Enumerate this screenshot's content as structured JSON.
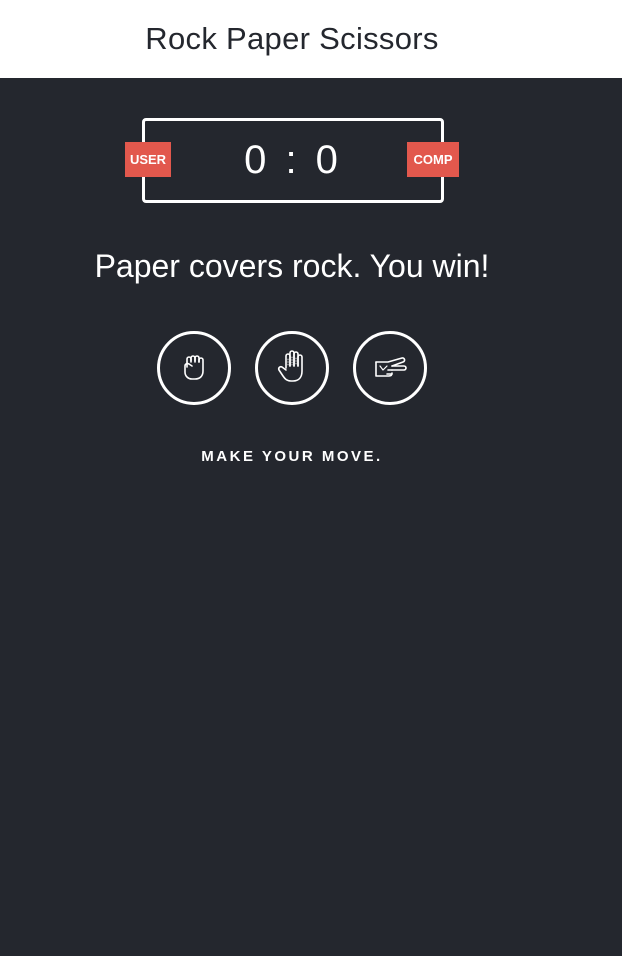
{
  "header": {
    "title": "Rock Paper Scissors"
  },
  "scoreboard": {
    "score_text": "0 : 0",
    "user_score": 0,
    "comp_score": 0,
    "user_label": "USER",
    "comp_label": "COMP"
  },
  "result": {
    "message": "Paper covers rock. You win!"
  },
  "choices": [
    {
      "id": "rock",
      "icon": "fist-icon"
    },
    {
      "id": "paper",
      "icon": "open-hand-icon"
    },
    {
      "id": "scissors",
      "icon": "scissors-hand-icon"
    }
  ],
  "prompt": {
    "text": "MAKE YOUR MOVE."
  },
  "colors": {
    "background": "#24272e",
    "header_bg": "#ffffff",
    "badge": "#e2584d",
    "text": "#ffffff"
  }
}
